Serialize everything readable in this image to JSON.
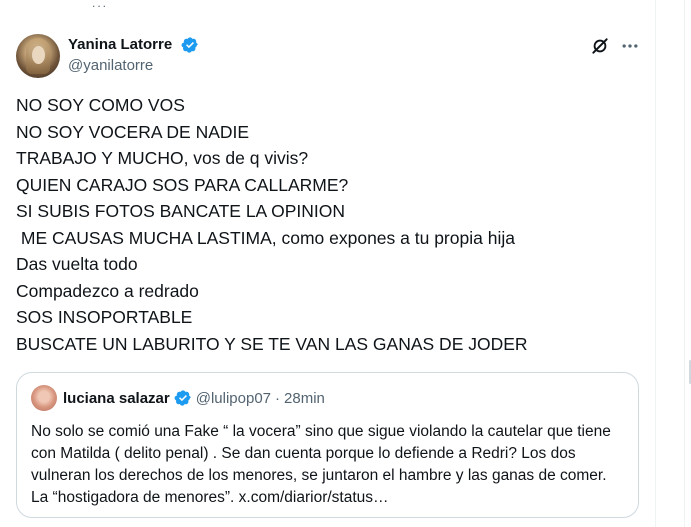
{
  "top_stub": "...",
  "tweet": {
    "display_name": "Yanina Latorre",
    "handle": "@yanilatorre",
    "body_lines": [
      "NO SOY COMO VOS",
      "NO SOY VOCERA DE NADIE",
      "TRABAJO Y MUCHO, vos de q vivis?",
      "QUIEN CARAJO SOS PARA CALLARME?",
      "SI SUBIS FOTOS BANCATE LA OPINION",
      " ME CAUSAS MUCHA LASTIMA, como expones a tu propia hija",
      "Das vuelta todo",
      "Compadezco a redrado",
      "SOS INSOPORTABLE",
      "BUSCATE UN LABURITO Y SE TE VAN LAS GANAS DE JODER"
    ],
    "icons": {
      "verified": "verified-badge-icon",
      "grok": "grok-icon",
      "more": "more-options-icon"
    }
  },
  "quote": {
    "display_name": "luciana salazar",
    "handle": "@lulipop07",
    "separator": "·",
    "time": "28min",
    "text": "No solo se comió una Fake “ la vocera” sino que sigue violando la cautelar que tiene con Matilda ( delito penal) . Se dan cuenta porque lo defiende a Redri? Los dos vulneran los derechos de los menores, se juntaron el hambre y las ganas de comer. La “hostigadora de menores”. x.com/diarior/status…"
  },
  "colors": {
    "text_primary": "#0f1419",
    "text_secondary": "#536471",
    "verified_blue": "#1d9bf0",
    "border": "#cfd9de"
  }
}
